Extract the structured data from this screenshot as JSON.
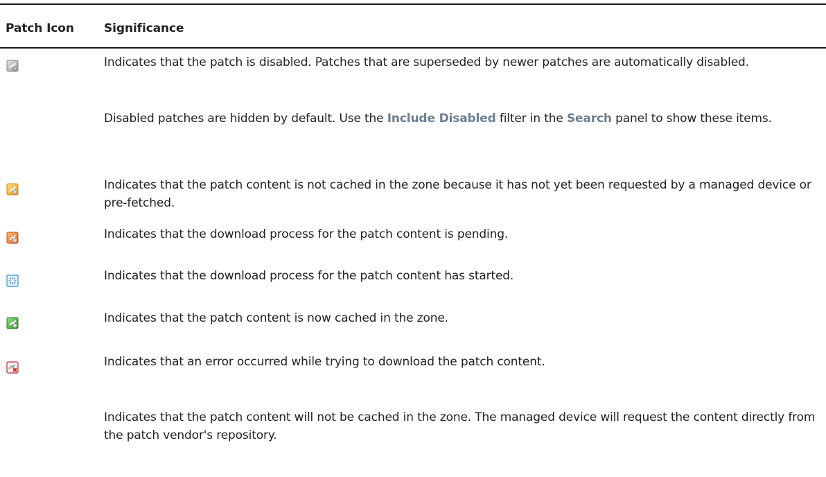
{
  "header": {
    "col_icon": "Patch Icon",
    "col_significance": "Significance"
  },
  "rows": [
    {
      "icon": "patch-disabled-icon",
      "text": "Indicates that the patch is disabled. Patches that are superseded by newer patches are automatically disabled."
    },
    {
      "icon": "",
      "text_before": "Disabled patches are hidden by default. Use the ",
      "filter_label": "Include Disabled",
      "text_middle": " filter in the ",
      "panel_label": "Search",
      "text_after": " panel to show these items."
    },
    {
      "icon": "patch-not-cached-icon",
      "text": "Indicates that the patch content is not cached in the zone because it has not yet been requested by a managed device or pre-fetched."
    },
    {
      "icon": "patch-download-pending-icon",
      "text": "Indicates that the download process for the patch content is pending."
    },
    {
      "icon": "patch-download-started-icon",
      "text": "Indicates that the download process for the patch content has started."
    },
    {
      "icon": "patch-cached-icon",
      "text": "Indicates that the patch content is now cached in the zone."
    },
    {
      "icon": "patch-download-error-icon",
      "text": "Indicates that an error occurred while trying to download the patch content."
    },
    {
      "icon": "",
      "text": "Indicates that the patch content will not be cached in the zone. The managed device will request the content directly from the patch vendor's repository."
    }
  ],
  "colors": {
    "rule": "#1a1a1a",
    "text": "#222222",
    "link": "#6b7f8f",
    "disabled_icon": "#9a9a9a",
    "not_cached_icon": "#f0b22a",
    "pending_icon": "#f07a2a",
    "started_icon": "#3a8fd0",
    "cached_icon": "#3a9e3a",
    "error_icon": "#d02a2a"
  }
}
